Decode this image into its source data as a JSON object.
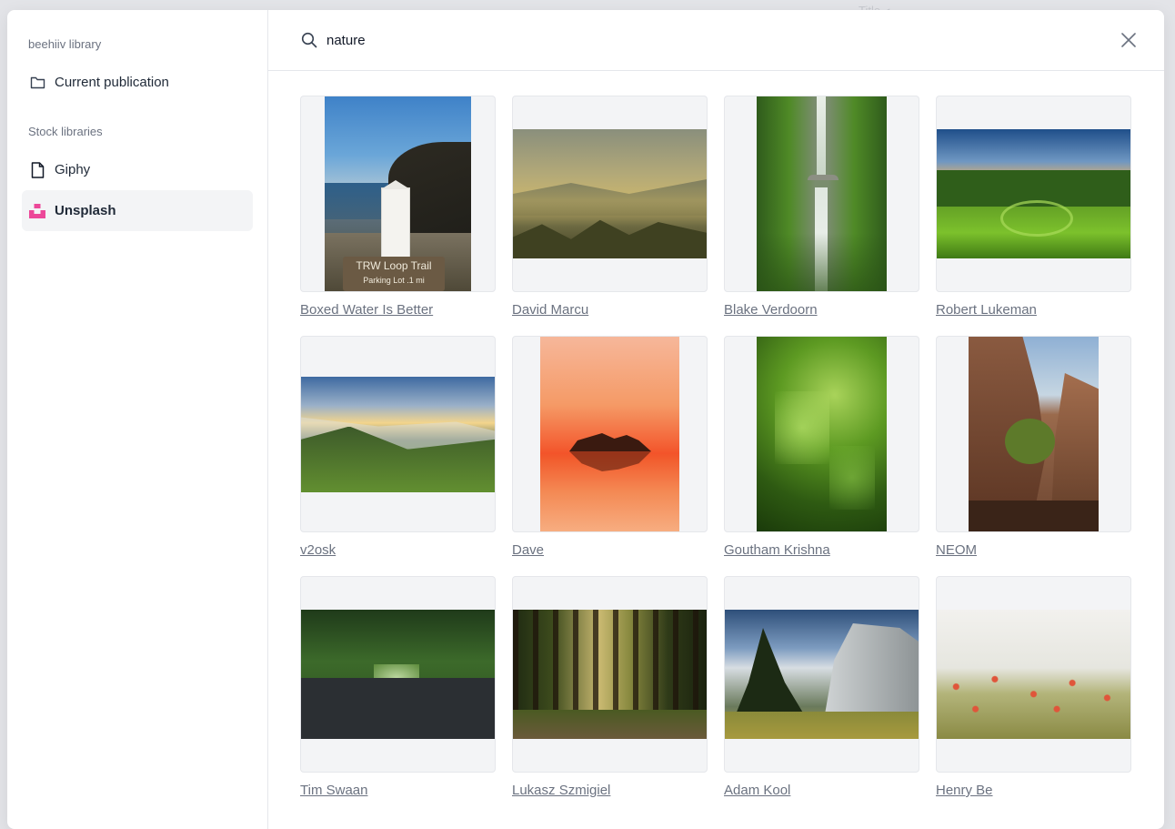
{
  "sidebar": {
    "library_label": "beehiiv library",
    "current_publication": "Current publication",
    "stock_label": "Stock libraries",
    "giphy": "Giphy",
    "unsplash": "Unsplash"
  },
  "search": {
    "value": "nature",
    "placeholder": "Search"
  },
  "photos": [
    {
      "credit": "Boxed Water Is Better"
    },
    {
      "credit": "David Marcu"
    },
    {
      "credit": "Blake Verdoorn"
    },
    {
      "credit": "Robert Lukeman"
    },
    {
      "credit": "v2osk"
    },
    {
      "credit": "Dave"
    },
    {
      "credit": "Goutham Krishna"
    },
    {
      "credit": "NEOM"
    },
    {
      "credit": "Tim Swaan"
    },
    {
      "credit": "Lukasz Szmigiel"
    },
    {
      "credit": "Adam Kool"
    },
    {
      "credit": "Henry Be"
    }
  ],
  "photo1_sign": {
    "line1": "TRW Loop Trail",
    "line2": "Parking Lot .1 mi"
  },
  "colors": {
    "unsplash_icon": "#ec4899",
    "active_bg": "#f3f4f6",
    "credit_text": "#6b7280"
  }
}
